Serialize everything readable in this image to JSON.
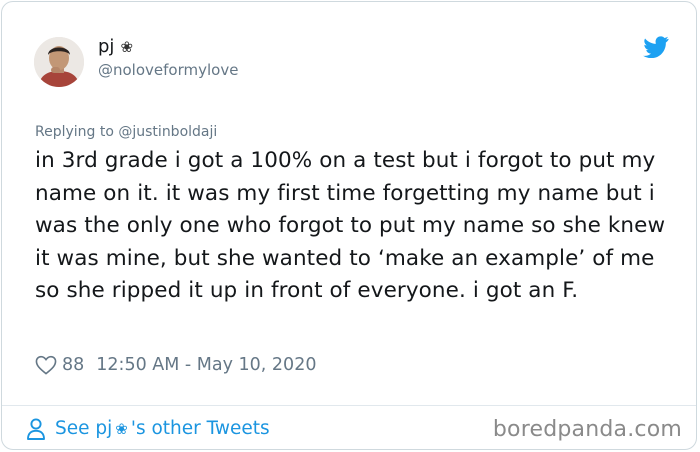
{
  "tweet": {
    "display_name": "pj",
    "name_emoji": "❀",
    "handle": "@noloveformylove",
    "replying_to": "Replying to @justinboldaji",
    "text": "in 3rd grade i got a 100% on a test but i forgot to put my name on it. it was my first time forgetting my name but i was the only one who forgot to put my name so she knew it was mine, but she wanted to ‘make an example’ of me so she ripped it up in front of everyone. i got an F.",
    "like_count": "88",
    "timestamp": "12:50 AM - May 10, 2020"
  },
  "footer": {
    "link_prefix": "See pj",
    "link_emoji": "❀",
    "link_suffix": "'s other Tweets"
  },
  "watermark": "boredpanda.com",
  "icons": {
    "avatar": "profile-photo",
    "brand": "twitter-bird-icon",
    "like": "heart-icon",
    "profile": "person-icon"
  },
  "colors": {
    "accent": "#1da1f2",
    "link": "#1b95e0",
    "text": "#14171a",
    "muted": "#657786",
    "border": "#cfd9de"
  }
}
